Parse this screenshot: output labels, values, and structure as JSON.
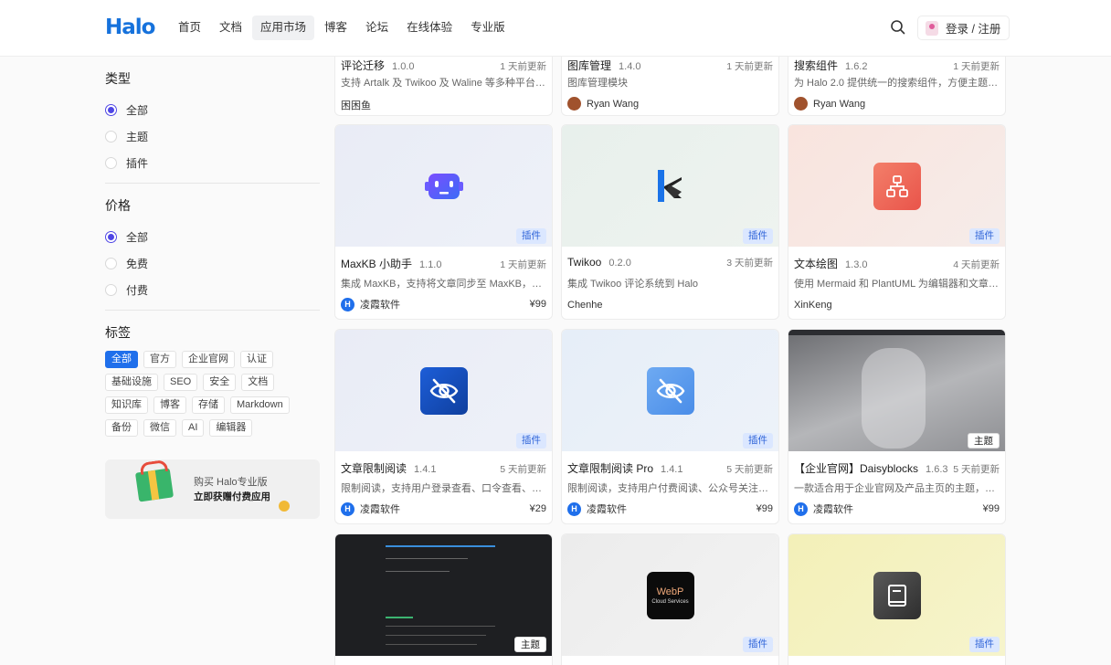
{
  "header": {
    "logo": "Halo",
    "nav": [
      "首页",
      "文档",
      "应用市场",
      "博客",
      "论坛",
      "在线体验",
      "专业版"
    ],
    "active_nav": "应用市场",
    "login": "登录 / 注册"
  },
  "sidebar": {
    "type_title": "类型",
    "type_options": [
      "全部",
      "主题",
      "插件"
    ],
    "price_title": "价格",
    "price_options": [
      "全部",
      "免费",
      "付费"
    ],
    "tags_title": "标签",
    "tags": [
      "全部",
      "官方",
      "企业官网",
      "认证",
      "基础设施",
      "SEO",
      "安全",
      "文档",
      "知识库",
      "博客",
      "存储",
      "Markdown",
      "备份",
      "微信",
      "AI",
      "编辑器"
    ],
    "promo_line1": "购买 Halo专业版",
    "promo_line2": "立即获赠付费应用"
  },
  "cards": [
    {
      "name": "评论迁移",
      "version": "1.0.0",
      "updated": "1 天前更新",
      "desc": "支持 Artalk 及 Twikoo 及 Waline 等多种平台的评...",
      "author": "困困鱼",
      "price": ""
    },
    {
      "name": "图库管理",
      "version": "1.4.0",
      "updated": "1 天前更新",
      "desc": "图库管理模块",
      "author": "Ryan Wang",
      "price": ""
    },
    {
      "name": "搜索组件",
      "version": "1.6.2",
      "updated": "1 天前更新",
      "desc": "为 Halo 2.0 提供统一的搜索组件，方便主题端使用。",
      "author": "Ryan Wang",
      "price": ""
    },
    {
      "name": "MaxKB 小助手",
      "version": "1.1.0",
      "updated": "1 天前更新",
      "desc": "集成 MaxKB，支持将文章同步至 MaxKB，并开启...",
      "author": "凌霞软件",
      "price": "¥99",
      "badge": "插件"
    },
    {
      "name": "Twikoo",
      "version": "0.2.0",
      "updated": "3 天前更新",
      "desc": "集成 Twikoo 评论系统到 Halo",
      "author": "Chenhe",
      "price": "",
      "badge": "插件"
    },
    {
      "name": "文本绘图",
      "version": "1.3.0",
      "updated": "4 天前更新",
      "desc": "使用 Mermaid 和 PlantUML 为编辑器和文章渲染...",
      "author": "XinKeng",
      "price": "",
      "badge": "插件"
    },
    {
      "name": "文章限制阅读",
      "version": "1.4.1",
      "updated": "5 天前更新",
      "desc": "限制阅读，支持用户登录查看、口令查看、评论之...",
      "author": "凌霞软件",
      "price": "¥29",
      "badge": "插件"
    },
    {
      "name": "文章限制阅读 Pro",
      "version": "1.4.1",
      "updated": "5 天前更新",
      "desc": "限制阅读，支持用户付费阅读、公众号关注、登录...",
      "author": "凌霞软件",
      "price": "¥99",
      "badge": "插件"
    },
    {
      "name": "【企业官网】Daisyblocks",
      "version": "1.6.3",
      "updated": "5 天前更新",
      "desc": "一款适合用于企业官网及产品主页的主题，通过不...",
      "author": "凌霞软件",
      "price": "¥99",
      "badge": "主题"
    },
    {
      "badge": "主题"
    },
    {
      "badge": "插件",
      "icon_text1": "WebP",
      "icon_text2": "Cloud Services"
    },
    {
      "badge": "插件"
    }
  ],
  "colors": {
    "accent": "#4f46e5",
    "brand": "#1672dc",
    "plugin_badge": "#dbe7ff"
  }
}
